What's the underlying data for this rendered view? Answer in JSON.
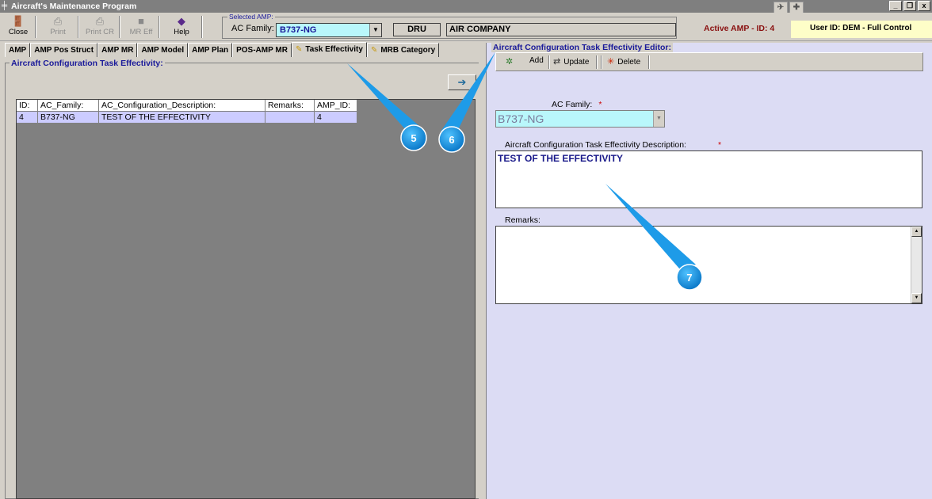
{
  "window": {
    "title": "Aircraft's Maintenance Program",
    "controls": [
      "_",
      "ő",
      "x"
    ]
  },
  "toolbar": {
    "close_label": "Close",
    "print_label": "Print",
    "print_cr_label": "Print CR",
    "mr_eff_label": "MR Eff",
    "help_label": "Help"
  },
  "selected_amp": {
    "legend": "Selected AMP:",
    "ac_family_label": "AC Family:",
    "ac_family_value": "B737-NG",
    "code": "DRU",
    "company": "AIR COMPANY"
  },
  "status": {
    "active_amp": "Active AMP - ID: 4",
    "user": "User ID: DEM - Full Control"
  },
  "tabs": [
    {
      "label": "AMP"
    },
    {
      "label": "AMP Pos Struct"
    },
    {
      "label": "AMP MR"
    },
    {
      "label": "AMP Model"
    },
    {
      "label": "AMP Plan"
    },
    {
      "label": "POS-AMP MR"
    },
    {
      "label": "Task Effectivity"
    },
    {
      "label": "MRB Category"
    }
  ],
  "left_panel": {
    "legend": "Aircraft Configuration Task Effectivity:",
    "arrow_icon": "arrow-right-icon",
    "columns": [
      "ID:",
      "AC_Family:",
      "AC_Configuration_Description:",
      "Remarks:",
      "AMP_ID:"
    ],
    "rows": [
      [
        "4",
        "B737-NG",
        "TEST OF THE EFFECTIVITY",
        "",
        "4"
      ]
    ]
  },
  "editor": {
    "legend": "Aircraft Configuration Task Effectivity Editor:",
    "add_label": "Add",
    "update_label": "Update",
    "delete_label": "Delete",
    "ac_family_label": "AC Family:",
    "ac_family_value": "B737-NG",
    "required_mark": "*",
    "description_label": "Aircraft Configuration Task Effectivity Description:",
    "description_value": "TEST OF THE EFFECTIVITY",
    "remarks_label": "Remarks:",
    "remarks_value": ""
  },
  "callouts": [
    {
      "number": "5"
    },
    {
      "number": "6"
    },
    {
      "number": "7"
    }
  ],
  "colors": {
    "callout_blue": "#1e9be8",
    "grid_selected": "#ccccff",
    "combo_cyan": "#b9f7fb",
    "editor_bg": "#dcdcf4",
    "user_box": "#fefec8"
  }
}
